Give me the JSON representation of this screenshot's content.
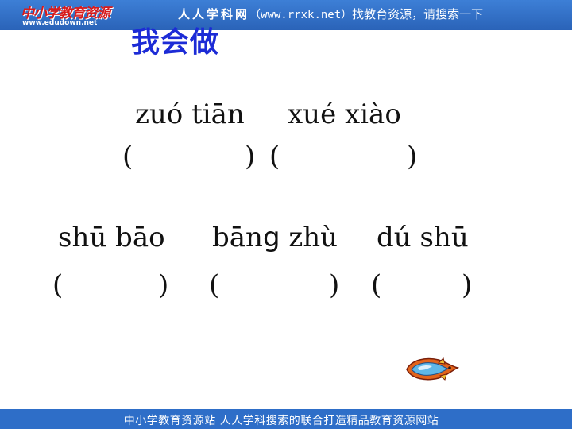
{
  "header": {
    "logo_title": "中小学教育资源",
    "logo_url": "www.edudown.net",
    "site_name": "人人学科网",
    "site_url_text": "（www.rrxk.net）",
    "slogan": "找教育资源，请搜索一下"
  },
  "title": "我会做",
  "row1": {
    "pinyin": [
      "zuó tiān",
      "xué xiào"
    ],
    "parens": [
      "(",
      ")",
      "(",
      ")"
    ]
  },
  "row2": {
    "pinyin_before_g": "bān",
    "pinyin_g": "g",
    "pinyin_after_g": " zhù",
    "pinyin": [
      "shū bāo",
      "dú  shū"
    ],
    "parens": [
      "(",
      ")",
      "(",
      ")",
      "(",
      ")"
    ]
  },
  "footer": {
    "text": "中小学教育资源站  人人学科搜索的联合打造精品教育资源网站"
  },
  "colors": {
    "header_bar": "#2a63b8",
    "title": "#1c2bd6",
    "footer_bar": "#2e6ec8"
  }
}
